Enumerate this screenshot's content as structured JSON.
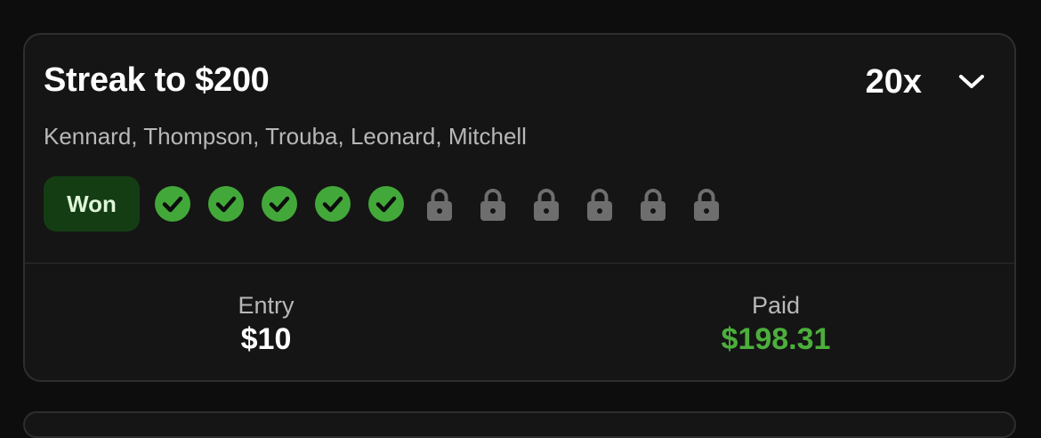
{
  "card": {
    "title": "Streak to $200",
    "multiplier": "20x",
    "players": "Kennard, Thompson, Trouba, Leonard, Mitchell",
    "status_label": "Won",
    "legs": [
      {
        "state": "won",
        "icon": "check-circle-icon"
      },
      {
        "state": "won",
        "icon": "check-circle-icon"
      },
      {
        "state": "won",
        "icon": "check-circle-icon"
      },
      {
        "state": "won",
        "icon": "check-circle-icon"
      },
      {
        "state": "won",
        "icon": "check-circle-icon"
      },
      {
        "state": "locked",
        "icon": "lock-icon"
      },
      {
        "state": "locked",
        "icon": "lock-icon"
      },
      {
        "state": "locked",
        "icon": "lock-icon"
      },
      {
        "state": "locked",
        "icon": "lock-icon"
      },
      {
        "state": "locked",
        "icon": "lock-icon"
      },
      {
        "state": "locked",
        "icon": "lock-icon"
      }
    ],
    "entry": {
      "label": "Entry",
      "value": "$10"
    },
    "paid": {
      "label": "Paid",
      "value": "$198.31"
    }
  },
  "colors": {
    "background": "#0d0d0d",
    "card": "#151515",
    "won_green": "#43a83a",
    "won_badge_bg": "#143d14",
    "paid_green": "#4caf3c",
    "locked_gray": "#6e6e6e"
  }
}
